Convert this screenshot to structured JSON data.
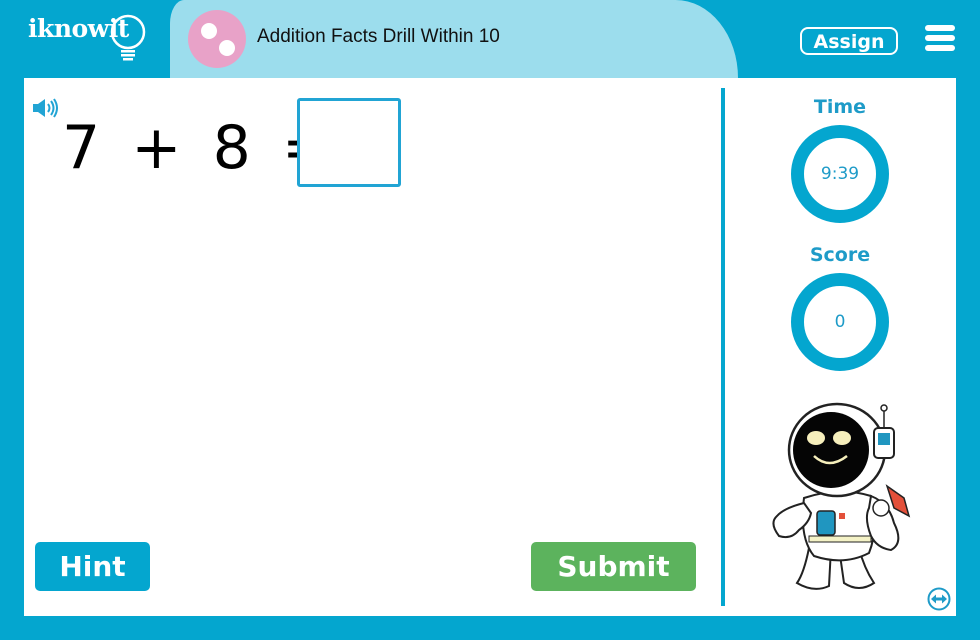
{
  "header": {
    "logo_text": "iknowit",
    "title": "Addition Facts Drill Within 10",
    "assign_label": "Assign",
    "menu_icon": "hamburger-menu-icon"
  },
  "question": {
    "operand_a": "7",
    "operator": "+",
    "operand_b": "8",
    "equals": "=",
    "answer_value": "",
    "speaker_icon": "speaker-icon"
  },
  "actions": {
    "hint_label": "Hint",
    "submit_label": "Submit"
  },
  "sidebar": {
    "time_label": "Time",
    "time_value": "9:39",
    "score_label": "Score",
    "score_value": "0",
    "mascot": "astronaut-mascot",
    "swap_icon": "swap-horizontal-icon"
  },
  "colors": {
    "brand_blue": "#04a6cf",
    "title_band": "#9cdded",
    "badge_pink": "#e8a2c8",
    "submit_green": "#5cb35d",
    "label_blue": "#1e9bc8"
  }
}
